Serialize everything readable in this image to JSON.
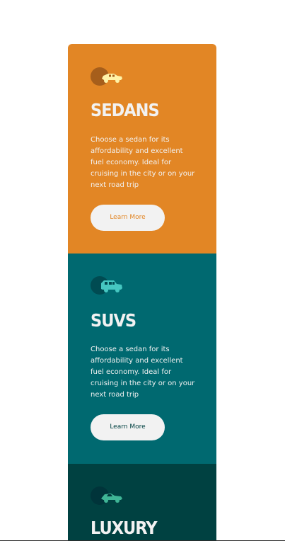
{
  "colors": {
    "page_background": "#ffffff",
    "sedans_background": "#e28625",
    "suvs_background": "#006970",
    "luxury_background": "#004141",
    "card_text": "#f2f2f2",
    "button_background": "#f2f2f2",
    "sedans_icon": "#fff3a8",
    "suvs_icon": "#46c7c1",
    "luxury_icon": "#3fb596"
  },
  "cards": [
    {
      "key": "sedans",
      "title": "Sedans",
      "icon": "sedan-icon",
      "description": "Choose a sedan for its affordability and excellent fuel economy. Ideal for cruising in the city or on your next road trip",
      "button_label": "Learn More"
    },
    {
      "key": "suvs",
      "title": "SUVs",
      "icon": "suv-icon",
      "description": "Choose a sedan for its affordability and excellent fuel economy. Ideal for cruising in the city or on your next road trip",
      "button_label": "Learn More"
    },
    {
      "key": "luxury",
      "title": "Luxury",
      "icon": "luxury-car-icon"
    }
  ]
}
